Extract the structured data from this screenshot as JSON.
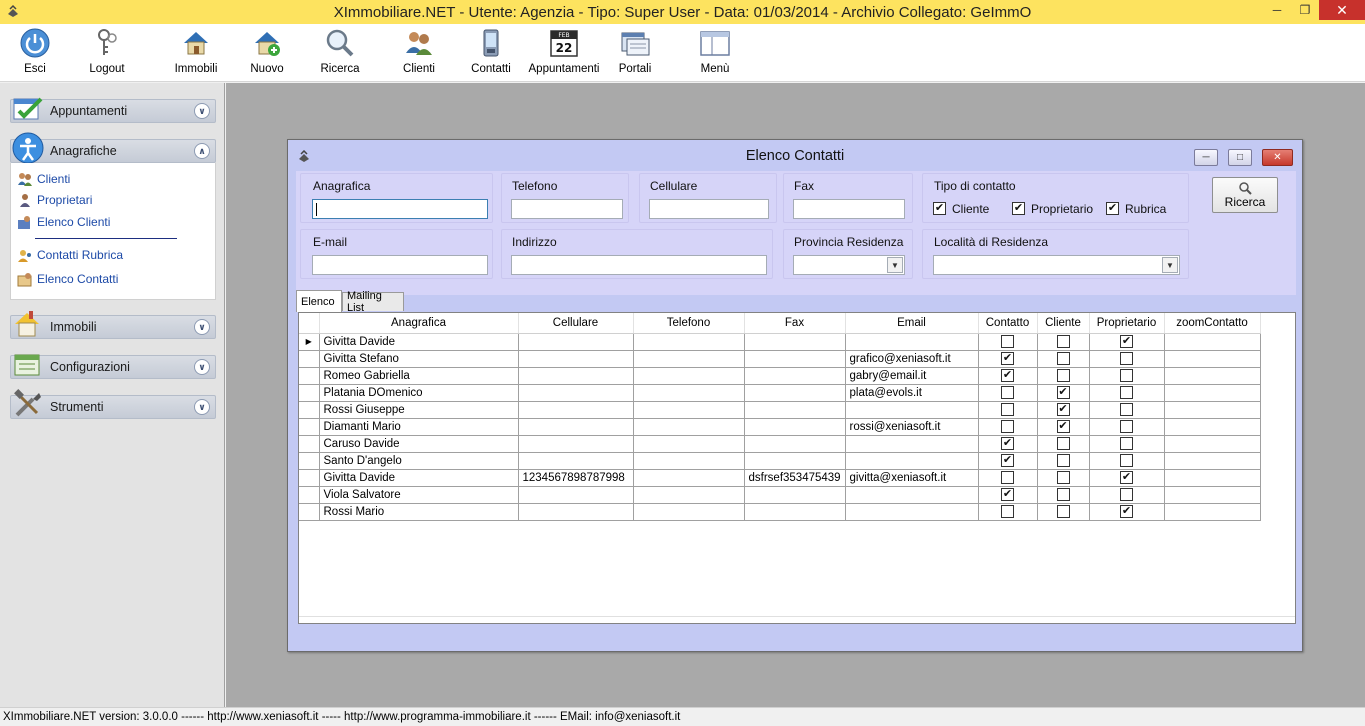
{
  "window": {
    "title": "XImmobiliare.NET - Utente: Agenzia - Tipo: Super User - Data: 01/03/2014 - Archivio Collegato: GeImmO"
  },
  "toolbar": {
    "items": [
      {
        "label": "Esci",
        "icon": "power-icon"
      },
      {
        "label": "Logout",
        "icon": "keys-icon"
      },
      {
        "label": "Immobili",
        "icon": "house-icon"
      },
      {
        "label": "Nuovo",
        "icon": "new-house-icon"
      },
      {
        "label": "Ricerca",
        "icon": "magnifier-icon"
      },
      {
        "label": "Clienti",
        "icon": "users-icon"
      },
      {
        "label": "Contatti",
        "icon": "phone-icon"
      },
      {
        "label": "Appuntamenti",
        "icon": "calendar-icon"
      },
      {
        "label": "Portali",
        "icon": "portal-icon"
      },
      {
        "label": "Menù",
        "icon": "window-icon"
      }
    ],
    "calendar_day": "22",
    "calendar_month": "FEB"
  },
  "sidebar": {
    "sections": [
      {
        "label": "Appuntamenti",
        "icon": "checklist-icon",
        "expanded": false
      },
      {
        "label": "Anagrafiche",
        "icon": "person-circle-icon",
        "expanded": true
      },
      {
        "label": "Immobili",
        "icon": "house-icon",
        "expanded": false
      },
      {
        "label": "Configurazioni",
        "icon": "config-icon",
        "expanded": false
      },
      {
        "label": "Strumenti",
        "icon": "tools-icon",
        "expanded": false
      }
    ],
    "anagrafiche_links": [
      {
        "label": "Clienti",
        "icon": "users-icon"
      },
      {
        "label": "Proprietari",
        "icon": "owner-icon"
      },
      {
        "label": "Elenco Clienti",
        "icon": "list-users-icon"
      },
      {
        "label": "Contatti Rubrica",
        "icon": "contacts-icon"
      },
      {
        "label": "Elenco Contatti",
        "icon": "list-contacts-icon"
      }
    ]
  },
  "contacts_window": {
    "title": "Elenco Contatti",
    "filters": {
      "anagrafica_label": "Anagrafica",
      "anagrafica_value": "",
      "telefono_label": "Telefono",
      "telefono_value": "",
      "cellulare_label": "Cellulare",
      "cellulare_value": "",
      "fax_label": "Fax",
      "fax_value": "",
      "tipo_label": "Tipo di contatto",
      "tipo_options": [
        {
          "label": "Cliente",
          "checked": true
        },
        {
          "label": "Proprietario",
          "checked": true
        },
        {
          "label": "Rubrica",
          "checked": true
        }
      ],
      "email_label": "E-mail",
      "email_value": "",
      "indirizzo_label": "Indirizzo",
      "indirizzo_value": "",
      "provincia_label": "Provincia Residenza",
      "provincia_value": "",
      "localita_label": "Località di Residenza",
      "localita_value": ""
    },
    "search_button": "Ricerca",
    "tabs": [
      "Elenco",
      "Mailing List"
    ],
    "active_tab": 0,
    "grid": {
      "columns": [
        "Anagrafica",
        "Cellulare",
        "Telefono",
        "Fax",
        "Email",
        "Contatto",
        "Cliente",
        "Proprietario",
        "zoomContatto"
      ],
      "rows": [
        {
          "anagrafica": "Givitta Davide",
          "cellulare": "",
          "telefono": "",
          "fax": "",
          "email": "",
          "contatto": false,
          "cliente": false,
          "proprietario": true,
          "current": true
        },
        {
          "anagrafica": "Givitta Stefano",
          "cellulare": "",
          "telefono": "",
          "fax": "",
          "email": "grafico@xeniasoft.it",
          "contatto": true,
          "cliente": false,
          "proprietario": false
        },
        {
          "anagrafica": "Romeo Gabriella",
          "cellulare": "",
          "telefono": "",
          "fax": "",
          "email": "gabry@email.it",
          "contatto": true,
          "cliente": false,
          "proprietario": false
        },
        {
          "anagrafica": "Platania DOmenico",
          "cellulare": "",
          "telefono": "",
          "fax": "",
          "email": "plata@evols.it",
          "contatto": false,
          "cliente": true,
          "proprietario": false
        },
        {
          "anagrafica": "Rossi Giuseppe",
          "cellulare": "",
          "telefono": "",
          "fax": "",
          "email": "",
          "contatto": false,
          "cliente": true,
          "proprietario": false
        },
        {
          "anagrafica": "Diamanti Mario",
          "cellulare": "",
          "telefono": "",
          "fax": "",
          "email": "rossi@xeniasoft.it",
          "contatto": false,
          "cliente": true,
          "proprietario": false
        },
        {
          "anagrafica": "Caruso Davide",
          "cellulare": "",
          "telefono": "",
          "fax": "",
          "email": "",
          "contatto": true,
          "cliente": false,
          "proprietario": false
        },
        {
          "anagrafica": "Santo D'angelo",
          "cellulare": "",
          "telefono": "",
          "fax": "",
          "email": "",
          "contatto": true,
          "cliente": false,
          "proprietario": false
        },
        {
          "anagrafica": "Givitta Davide",
          "cellulare": "1234567898787998",
          "telefono": "",
          "fax": "dsfrsef353475439",
          "email": "givitta@xeniasoft.it",
          "contatto": false,
          "cliente": false,
          "proprietario": true
        },
        {
          "anagrafica": "Viola Salvatore",
          "cellulare": "",
          "telefono": "",
          "fax": "",
          "email": "",
          "contatto": true,
          "cliente": false,
          "proprietario": false
        },
        {
          "anagrafica": "Rossi Mario",
          "cellulare": "",
          "telefono": "",
          "fax": "",
          "email": "",
          "contatto": false,
          "cliente": false,
          "proprietario": true
        }
      ]
    }
  },
  "statusbar": {
    "text": "XImmobiliare.NET version: 3.0.0.0 ------ http://www.xeniasoft.it ----- http://www.programma-immobiliare.it ------ EMail: info@xeniasoft.it"
  },
  "colors": {
    "titlebar": "#fde35f",
    "workspace": "#a9a9a9",
    "child_window": "#c3c9f3",
    "filter_panel": "#d6d4f8",
    "link": "#1d4aa7"
  }
}
